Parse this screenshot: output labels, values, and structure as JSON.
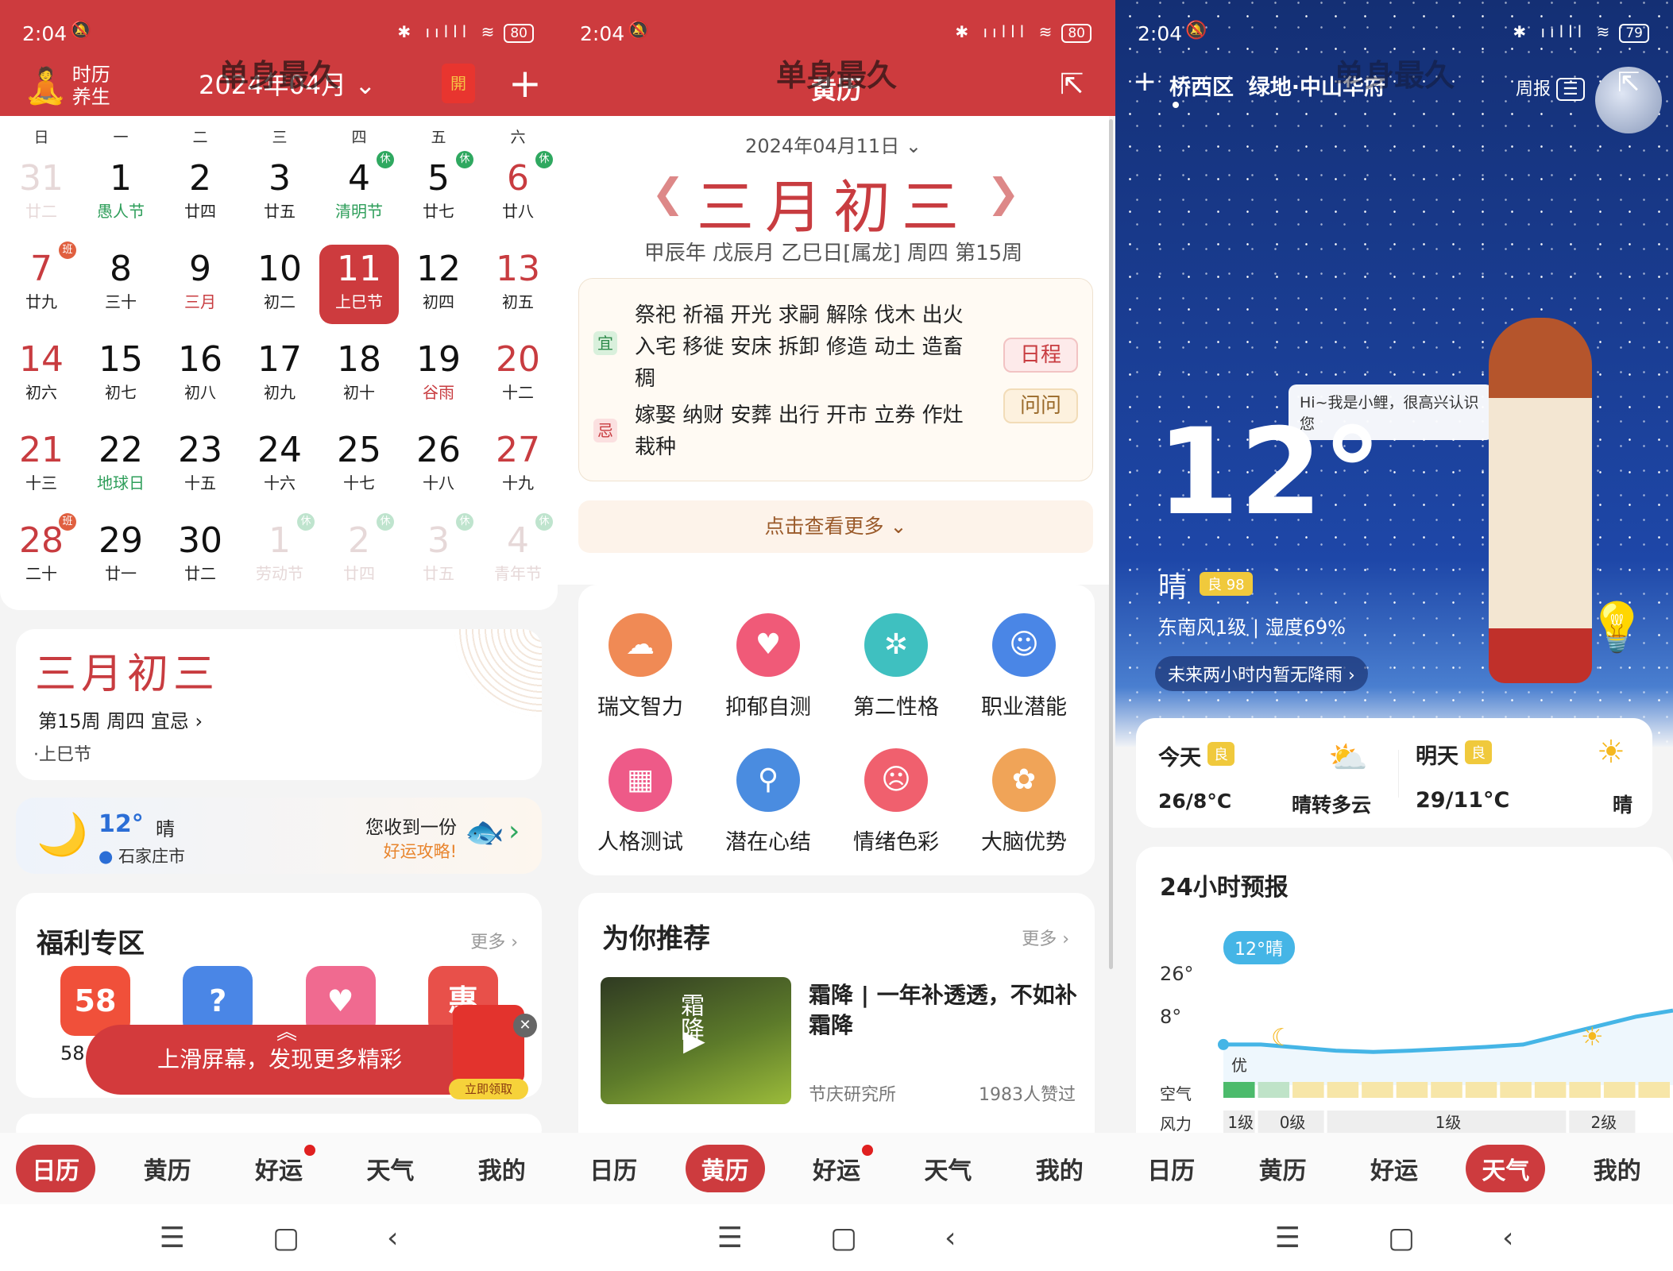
{
  "watermark": "单身最久",
  "colors": {
    "primary_red": "#cd3b3e",
    "rest_green": "#2fa860",
    "work_badge": "#e06040",
    "sky_blue": "#1c3d8f",
    "chart_line": "#45b5e6",
    "aqi_badge": "#f0c93c"
  },
  "status_bars": [
    {
      "time": "2:04",
      "battery": "80"
    },
    {
      "time": "2:04",
      "battery": "80"
    },
    {
      "time": "2:04",
      "battery": "79"
    }
  ],
  "calendar_panel": {
    "logo_line1": "时历",
    "logo_line2": "养生",
    "month_title": "2024年04月",
    "weekdays": [
      "日",
      "一",
      "二",
      "三",
      "四",
      "五",
      "六"
    ],
    "days": [
      [
        {
          "d": "31",
          "l": "廿二",
          "t": "faded"
        },
        {
          "d": "1",
          "l": "愚人节",
          "lc": "green"
        },
        {
          "d": "2",
          "l": "廿四"
        },
        {
          "d": "3",
          "l": "廿五"
        },
        {
          "d": "4",
          "l": "清明节",
          "lc": "green",
          "b": "休"
        },
        {
          "d": "5",
          "l": "廿七",
          "b": "休"
        },
        {
          "d": "6",
          "l": "廿八",
          "t": "red",
          "b": "休"
        }
      ],
      [
        {
          "d": "7",
          "l": "廿九",
          "t": "red",
          "b": "班"
        },
        {
          "d": "8",
          "l": "三十"
        },
        {
          "d": "9",
          "l": "三月",
          "lc": "redl"
        },
        {
          "d": "10",
          "l": "初二"
        },
        {
          "d": "11",
          "l": "上巳节",
          "t": "sel"
        },
        {
          "d": "12",
          "l": "初四"
        },
        {
          "d": "13",
          "l": "初五",
          "t": "red"
        }
      ],
      [
        {
          "d": "14",
          "l": "初六",
          "t": "red"
        },
        {
          "d": "15",
          "l": "初七"
        },
        {
          "d": "16",
          "l": "初八"
        },
        {
          "d": "17",
          "l": "初九"
        },
        {
          "d": "18",
          "l": "初十"
        },
        {
          "d": "19",
          "l": "谷雨",
          "lc": "redl"
        },
        {
          "d": "20",
          "l": "十二",
          "t": "red"
        }
      ],
      [
        {
          "d": "21",
          "l": "十三",
          "t": "red"
        },
        {
          "d": "22",
          "l": "地球日",
          "lc": "green"
        },
        {
          "d": "23",
          "l": "十五"
        },
        {
          "d": "24",
          "l": "十六"
        },
        {
          "d": "25",
          "l": "十七"
        },
        {
          "d": "26",
          "l": "十八"
        },
        {
          "d": "27",
          "l": "十九",
          "t": "red"
        }
      ],
      [
        {
          "d": "28",
          "l": "二十",
          "t": "red",
          "b": "班"
        },
        {
          "d": "29",
          "l": "廿一"
        },
        {
          "d": "30",
          "l": "廿二"
        },
        {
          "d": "1",
          "l": "劳动节",
          "t": "faded",
          "b": "休"
        },
        {
          "d": "2",
          "l": "廿四",
          "t": "faded",
          "b": "休"
        },
        {
          "d": "3",
          "l": "廿五",
          "t": "faded",
          "b": "休"
        },
        {
          "d": "4",
          "l": "青年节",
          "t": "faded",
          "b": "休"
        }
      ]
    ],
    "lunar_card": {
      "lunar_date": "三月初三",
      "subtitle": "第15周 周四 宜忌",
      "festival": "·上巳节"
    },
    "weather_card": {
      "temp": "12°",
      "condition": "晴",
      "city": "石家庄市",
      "promo_line1": "您收到一份",
      "promo_line2": "好运攻略!"
    },
    "welfare": {
      "title": "福利专区",
      "more": "更多",
      "items": [
        {
          "glyph": "58",
          "label": "58"
        },
        {
          "glyph": "?"
        },
        {
          "glyph": "♥"
        },
        {
          "glyph": "惠"
        }
      ]
    },
    "banner": {
      "text": "上滑屏幕，发现更多精彩",
      "claim": "立即领取"
    }
  },
  "huangli_panel": {
    "title": "黄历",
    "date": "2024年04月11日",
    "lunar_date": "三月初三",
    "ganzhi": "甲辰年 戊辰月 乙巳日[属龙] 周四 第15周",
    "yi_label": "宜",
    "yi": "祭祀 祈福 开光 求嗣 解除 伐木 出火 入宅 移徙 安床 拆卸 修造 动土 造畜稠",
    "ji_label": "忌",
    "ji": "嫁娶 纳财 安葬 出行 开市 立券 作灶 栽种",
    "schedule_btn": "日程",
    "ask_btn": "问问",
    "more_btn": "点击查看更多",
    "tests": [
      {
        "label": "瑞文智力",
        "color": "#f08a55",
        "glyph": "☁"
      },
      {
        "label": "抑郁自测",
        "color": "#f05a78",
        "glyph": "♥"
      },
      {
        "label": "第二性格",
        "color": "#3fc0c0",
        "glyph": "✲"
      },
      {
        "label": "职业潜能",
        "color": "#4a86e6",
        "glyph": "☺"
      },
      {
        "label": "人格测试",
        "color": "#ee5a88",
        "glyph": "▦"
      },
      {
        "label": "潜在心结",
        "color": "#4a8ce0",
        "glyph": "⚲"
      },
      {
        "label": "情绪色彩",
        "color": "#f0606e",
        "glyph": "☹"
      },
      {
        "label": "大脑优势",
        "color": "#f0a458",
        "glyph": "✿"
      }
    ],
    "recommend": {
      "title": "为你推荐",
      "more": "更多",
      "article_title": "霜降 | 一年补透透，不如补霜降",
      "source": "节庆研究所",
      "likes": "1983人赞过",
      "thumb_text": "霜降"
    }
  },
  "weather_panel": {
    "location": "桥西区  绿地·中山华府",
    "weekly": "周报",
    "temp": "12°",
    "bubble": "Hi~我是小鲤，很高兴认识您",
    "condition": "晴",
    "aqi": "良 98",
    "wind_humidity": "东南风1级 | 湿度69%",
    "rain_notice": "未来两小时内暂无降雨",
    "today": {
      "label": "今天",
      "aqi": "良",
      "range": "26/8°C",
      "cond": "晴转多云",
      "icon": "partly-cloudy-night-icon"
    },
    "tomorrow": {
      "label": "明天",
      "aqi": "良",
      "range": "29/11°C",
      "cond": "晴",
      "icon": "sun-icon"
    },
    "forecast_title": "24小时预报",
    "air_label": "空气",
    "wind_label": "风力",
    "air_first": "优"
  },
  "chart_data": {
    "type": "line",
    "title": "24小时预报",
    "y_tick_labels": [
      "26°",
      "8°"
    ],
    "ylim": [
      8,
      26
    ],
    "current_label": "12°晴",
    "series": [
      {
        "values": [
          12,
          12,
          11.5,
          11,
          10.8,
          11,
          11.3,
          11.6,
          12,
          13.5,
          15,
          16.5,
          17.5
        ]
      }
    ],
    "air_quality": [
      "优",
      "良",
      "良",
      "良",
      "良",
      "良",
      "良",
      "良",
      "良",
      "良",
      "良",
      "良",
      "良"
    ],
    "air_colors": {
      "优": "#4cbb6c",
      "良_light": "#bfe3c8",
      "良": "#f7e6a8"
    },
    "wind": [
      {
        "label": "1级",
        "span": 1
      },
      {
        "label": "0级",
        "span": 2
      },
      {
        "label": "1级",
        "span": 7
      },
      {
        "label": "2级",
        "span": 2
      }
    ]
  },
  "nav": {
    "tabs": [
      "日历",
      "黄历",
      "好运",
      "天气",
      "我的"
    ],
    "active": [
      0,
      1,
      3
    ]
  }
}
